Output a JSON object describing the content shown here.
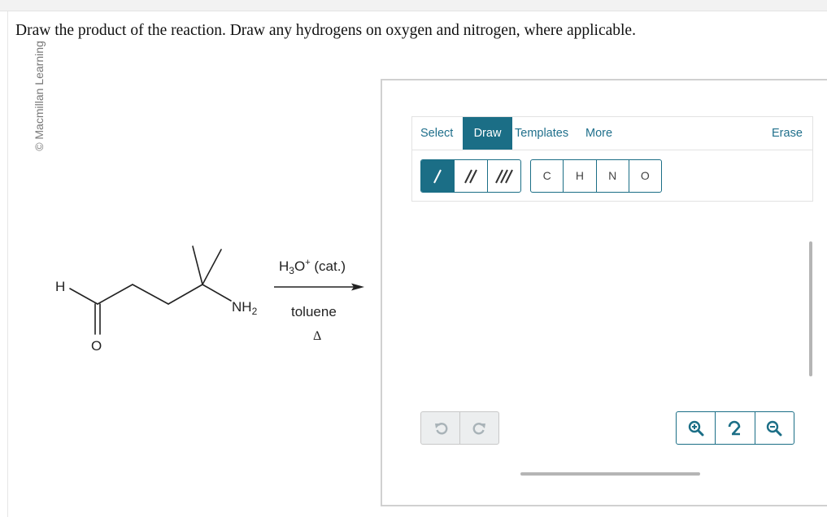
{
  "question": "Draw the product of the reaction. Draw any hydrogens on oxygen and nitrogen, where applicable.",
  "watermark": "© Macmillan Learning",
  "scheme": {
    "atoms": {
      "h": "H",
      "o": "O",
      "n": "NH",
      "n_sub": "2"
    },
    "reagents": {
      "line1_main": "H",
      "line1_sub": "3",
      "line1_mid": "O",
      "line1_sup": "+",
      "line1_end": " (cat.)",
      "line2": "toluene",
      "line3": "Δ"
    }
  },
  "editor": {
    "tabs": {
      "select": "Select",
      "draw": "Draw",
      "templates": "Templates",
      "more": "More",
      "erase": "Erase"
    },
    "active_tab": "Draw",
    "atoms": [
      "C",
      "H",
      "N",
      "O"
    ],
    "accent_color": "#1b6e86"
  }
}
